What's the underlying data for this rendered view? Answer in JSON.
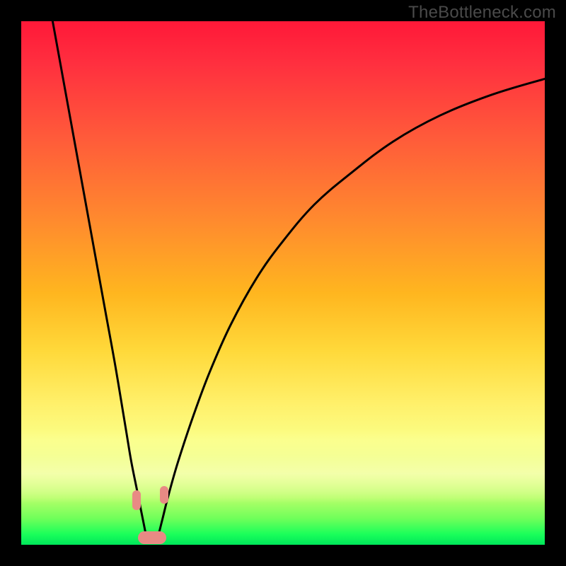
{
  "watermark": "TheBottleneck.com",
  "chart_data": {
    "type": "line",
    "title": "",
    "xlabel": "",
    "ylabel": "",
    "xlim": [
      0,
      100
    ],
    "ylim": [
      0,
      100
    ],
    "grid": false,
    "legend": false,
    "annotations": [],
    "note": "V-shaped bottleneck curve over red→green vertical gradient. y≈0 is optimal (green band). Valley near x≈24. Values estimated from pixel positions; no axes or tick labels are rendered.",
    "series": [
      {
        "name": "left-branch",
        "x": [
          6,
          8,
          10,
          12,
          14,
          16,
          18,
          20,
          21,
          22,
          23,
          24
        ],
        "y": [
          100,
          89,
          78,
          67,
          56,
          45,
          34,
          22,
          16,
          11,
          6,
          1
        ]
      },
      {
        "name": "right-branch",
        "x": [
          26,
          27,
          28,
          30,
          33,
          36,
          40,
          45,
          50,
          56,
          63,
          71,
          80,
          90,
          100
        ],
        "y": [
          1,
          5,
          9,
          16,
          25,
          33,
          42,
          51,
          58,
          65,
          71,
          77,
          82,
          86,
          89
        ]
      }
    ],
    "markers": [
      {
        "name": "valley-left-blob",
        "cx": 22.0,
        "cy": 8.5,
        "w": 1.6,
        "h": 3.8
      },
      {
        "name": "valley-right-blob",
        "cx": 27.3,
        "cy": 9.5,
        "w": 1.6,
        "h": 3.4
      },
      {
        "name": "valley-bottom-blob",
        "cx": 25.0,
        "cy": 1.4,
        "w": 5.4,
        "h": 2.4
      }
    ],
    "colors": {
      "curve": "#000000",
      "marker": "#e88a84",
      "gradient_top": "#ff1838",
      "gradient_bottom": "#00e65a"
    }
  }
}
